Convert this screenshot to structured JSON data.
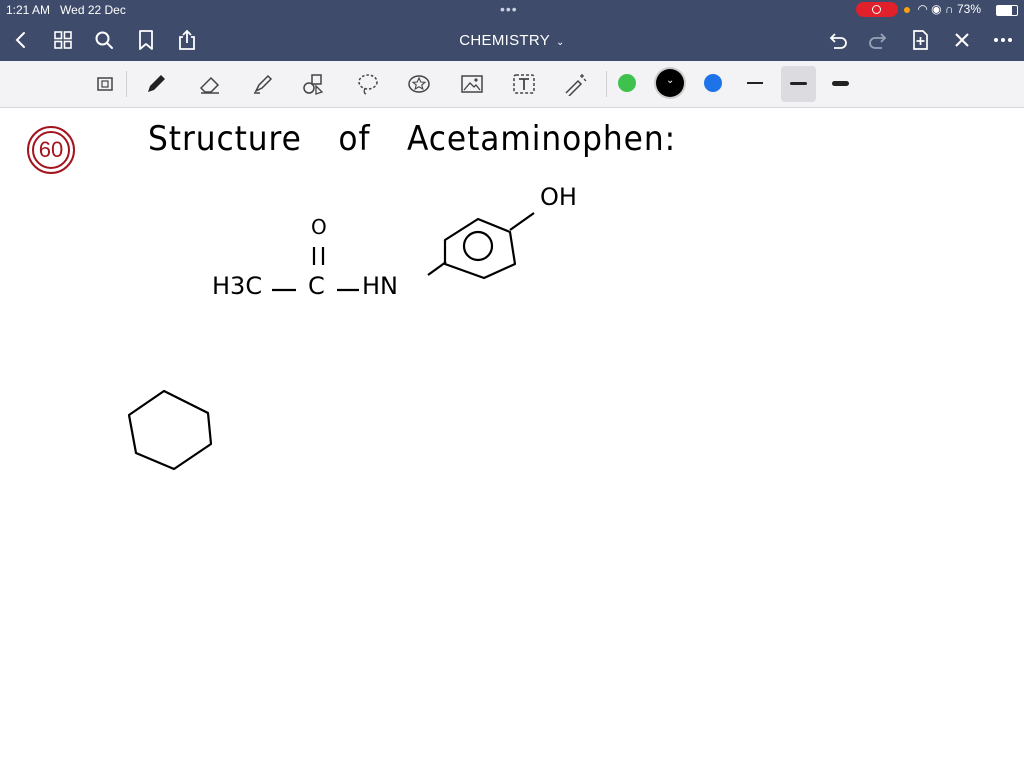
{
  "status_bar": {
    "time": "1:21 AM",
    "date": "Wed 22 Dec",
    "battery": "73%"
  },
  "nav": {
    "title": "CHEMISTRY",
    "icons": [
      "back-icon",
      "grid-icon",
      "search-icon",
      "bookmark-icon",
      "share-icon",
      "undo-icon",
      "redo-icon",
      "add-page-icon",
      "close-icon",
      "more-icon"
    ]
  },
  "toolbar": {
    "tools": [
      "page-view-icon",
      "pen-icon",
      "eraser-icon",
      "highlighter-icon",
      "shapes-icon",
      "lasso-icon",
      "sticker-icon",
      "image-icon",
      "text-icon",
      "laser-icon"
    ],
    "colors": [
      "#3fc24d",
      "#000000",
      "#1f73e8"
    ],
    "selected_color": "#000000",
    "selected_pen_width": "medium"
  },
  "note": {
    "question_number": "60",
    "heading": "Structure of Acetaminophen:",
    "labels": {
      "oh": "OH",
      "o": "O",
      "h3c": "H3C",
      "c": "C",
      "hn": "HN"
    }
  }
}
